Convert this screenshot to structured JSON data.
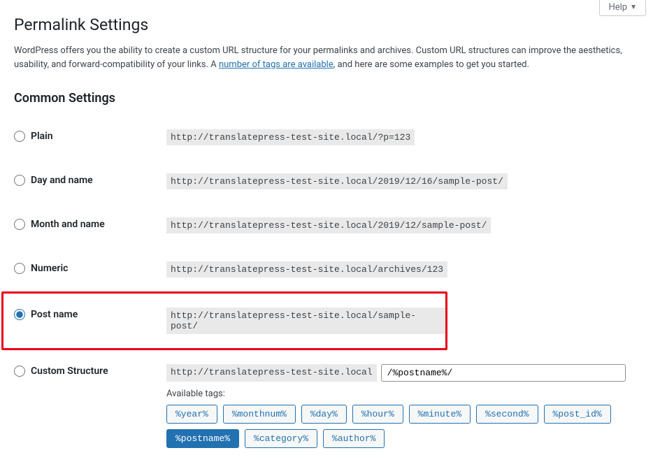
{
  "help_label": "Help",
  "page_title": "Permalink Settings",
  "intro_text_1": "WordPress offers you the ability to create a custom URL structure for your permalinks and archives. Custom URL structures can improve the aesthetics, usability, and forward-compatibility of your links. A ",
  "intro_link_text": "number of tags are available",
  "intro_text_2": ", and here are some examples to get you started.",
  "common_settings_heading": "Common Settings",
  "options": {
    "plain": {
      "label": "Plain",
      "example": "http://translatepress-test-site.local/?p=123"
    },
    "day_name": {
      "label": "Day and name",
      "example": "http://translatepress-test-site.local/2019/12/16/sample-post/"
    },
    "month_name": {
      "label": "Month and name",
      "example": "http://translatepress-test-site.local/2019/12/sample-post/"
    },
    "numeric": {
      "label": "Numeric",
      "example": "http://translatepress-test-site.local/archives/123"
    },
    "post_name": {
      "label": "Post name",
      "example": "http://translatepress-test-site.local/sample-post/"
    },
    "custom": {
      "label": "Custom Structure",
      "base": "http://translatepress-test-site.local",
      "value": "/%postname%/"
    }
  },
  "available_tags_label": "Available tags:",
  "tags": {
    "year": "%year%",
    "monthnum": "%monthnum%",
    "day": "%day%",
    "hour": "%hour%",
    "minute": "%minute%",
    "second": "%second%",
    "post_id": "%post_id%",
    "postname": "%postname%",
    "category": "%category%",
    "author": "%author%"
  }
}
